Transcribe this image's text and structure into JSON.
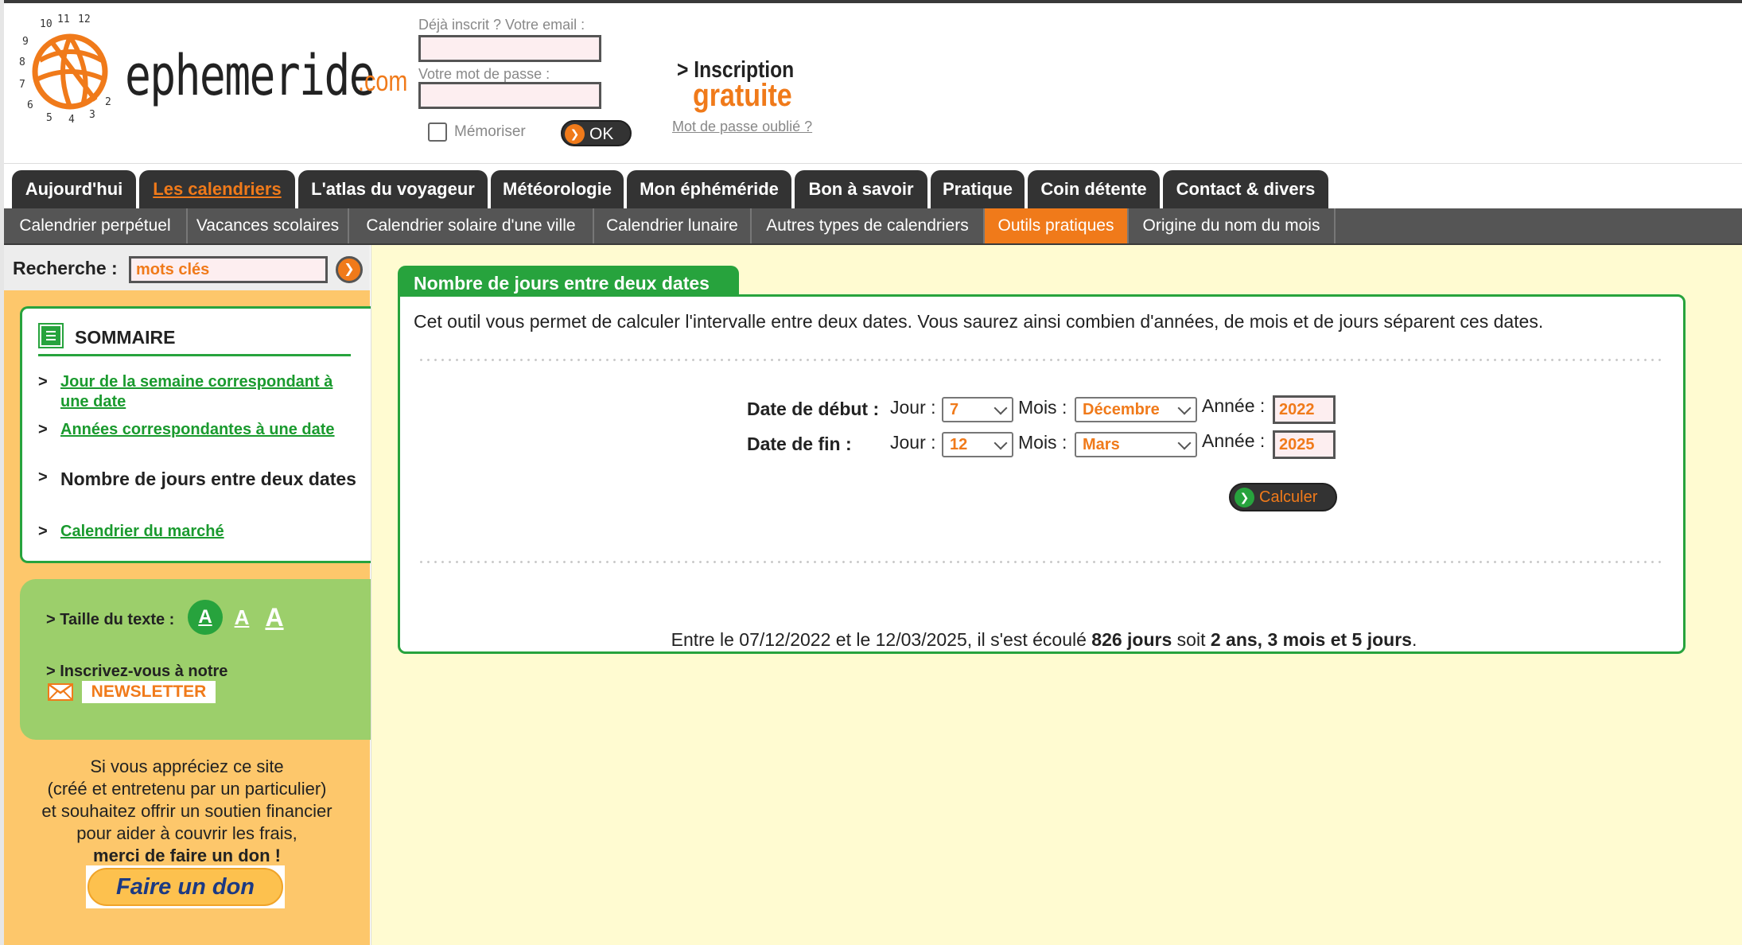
{
  "logo": {
    "brand": "ephemeride",
    "tld": ".com"
  },
  "login": {
    "email_label": "Déjà inscrit ? Votre email :",
    "email_value": "",
    "password_label": "Votre mot de passe :",
    "password_value": "",
    "remember_label": "Mémoriser",
    "ok_label": "OK",
    "signup_line1": "> Inscription",
    "signup_line2": "gratuite",
    "forgot_link": "Mot de passe oublié ?"
  },
  "main_nav": [
    {
      "label": "Aujourd'hui"
    },
    {
      "label": "Les calendriers",
      "active": true
    },
    {
      "label": "L'atlas du voyageur"
    },
    {
      "label": "Météorologie"
    },
    {
      "label": "Mon éphéméride"
    },
    {
      "label": "Bon à savoir"
    },
    {
      "label": "Pratique"
    },
    {
      "label": "Coin détente"
    },
    {
      "label": "Contact & divers"
    }
  ],
  "sub_nav": [
    {
      "label": "Calendrier perpétuel"
    },
    {
      "label": "Vacances scolaires"
    },
    {
      "label": "Calendrier solaire d'une ville"
    },
    {
      "label": "Calendrier lunaire"
    },
    {
      "label": "Autres types de calendriers"
    },
    {
      "label": "Outils pratiques",
      "active": true
    },
    {
      "label": "Origine du nom du mois"
    }
  ],
  "search": {
    "label": "Recherche :",
    "value": "mots clés"
  },
  "sommaire": {
    "title": "SOMMAIRE",
    "items": [
      {
        "label": "Jour de la semaine correspondant à une date"
      },
      {
        "label": "Années correspondantes à une date"
      },
      {
        "label": "Nombre de jours entre deux dates",
        "current": true
      },
      {
        "label": "Calendrier du marché"
      }
    ]
  },
  "tools": {
    "text_size_label": "> Taille du texte :",
    "size_small": "A",
    "size_medium": "A",
    "size_large": "A",
    "newsletter_label": "> Inscrivez-vous à notre",
    "newsletter_badge": "NEWSLETTER"
  },
  "donation": {
    "line1": "Si vous appréciez ce site",
    "line2": "(créé et entretenu par un particulier)",
    "line3": "et souhaitez offrir un soutien financier",
    "line4": "pour aider à couvrir les frais,",
    "line5": "merci de faire un don !",
    "button": "Faire un don"
  },
  "tool": {
    "title": "Nombre de jours entre deux dates",
    "description": "Cet outil vous permet de calculer l'intervalle entre deux dates. Vous saurez ainsi combien d'années, de mois et de jours séparent ces dates.",
    "start_label": "Date de début :",
    "end_label": "Date de fin :",
    "day_label": "Jour :",
    "month_label": "Mois :",
    "year_label": "Année :",
    "start": {
      "day": "7",
      "month": "Décembre",
      "year": "2022"
    },
    "end": {
      "day": "12",
      "month": "Mars",
      "year": "2025"
    },
    "calc_label": "Calculer",
    "result": {
      "prefix": "Entre le 07/12/2022 et le 12/03/2025, il s'est écoulé",
      "days": "826 jours",
      "middle": "soit",
      "duration": "2 ans, 3 mois et 5 jours",
      "suffix": "."
    }
  },
  "colors": {
    "accent": "#f07a1a",
    "green": "#27a33d",
    "dark": "#333333",
    "sidebar": "#fdc76b",
    "content_bg": "#fffbd1"
  }
}
